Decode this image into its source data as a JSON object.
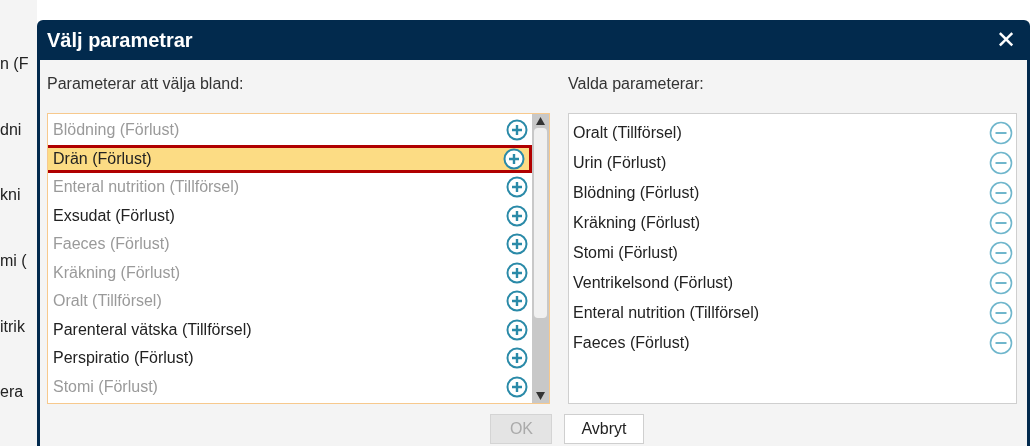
{
  "background_fragments": [
    "n (F",
    "dni",
    "kni",
    "mi (",
    "itrik",
    "era"
  ],
  "dialog": {
    "title": "Välj parametrar",
    "close": "✕",
    "available": {
      "label": "Parameterar att välja bland:",
      "items": [
        {
          "label": "Blödning (Förlust)",
          "disabled": true,
          "selected": false
        },
        {
          "label": "Drän (Förlust)",
          "disabled": false,
          "selected": true
        },
        {
          "label": "Enteral nutrition (Tillförsel)",
          "disabled": true,
          "selected": false
        },
        {
          "label": "Exsudat (Förlust)",
          "disabled": false,
          "selected": false
        },
        {
          "label": "Faeces (Förlust)",
          "disabled": true,
          "selected": false
        },
        {
          "label": "Kräkning (Förlust)",
          "disabled": true,
          "selected": false
        },
        {
          "label": "Oralt (Tillförsel)",
          "disabled": true,
          "selected": false
        },
        {
          "label": "Parenteral vätska (Tillförsel)",
          "disabled": false,
          "selected": false
        },
        {
          "label": "Perspiratio (Förlust)",
          "disabled": false,
          "selected": false
        },
        {
          "label": "Stomi (Förlust)",
          "disabled": true,
          "selected": false
        }
      ]
    },
    "chosen": {
      "label": "Valda parameterar:",
      "items": [
        "Oralt (Tillförsel)",
        "Urin (Förlust)",
        "Blödning (Förlust)",
        "Kräkning (Förlust)",
        "Stomi (Förlust)",
        "Ventrikelsond (Förlust)",
        "Enteral nutrition (Tillförsel)",
        "Faeces (Förlust)"
      ]
    },
    "buttons": [
      {
        "label": "OK",
        "disabled": true
      },
      {
        "label": "Avbryt",
        "disabled": false
      }
    ]
  }
}
